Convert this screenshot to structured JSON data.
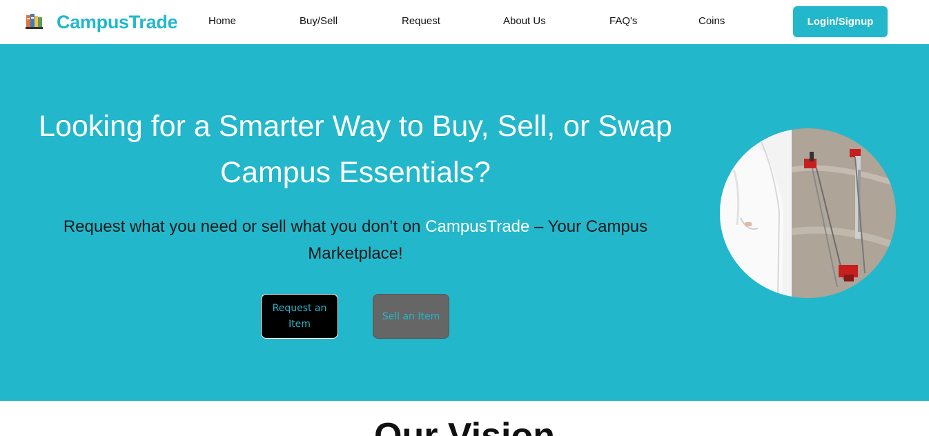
{
  "nav": {
    "brand": "CampusTrade",
    "links": [
      "Home",
      "Buy/Sell",
      "Request",
      "About Us",
      "FAQ's",
      "Coins"
    ],
    "login_label": "Login/Signup"
  },
  "hero": {
    "title": "Looking for a Smarter Way to Buy, Sell, or Swap Campus Essentials?",
    "subtitle_pre": "Request what you need or sell what you don’t on ",
    "subtitle_brand": "CampusTrade",
    "subtitle_post": " – Your Campus Marketplace!",
    "request_button": "Request an Item",
    "sell_button": "Sell an Item"
  },
  "vision": {
    "heading": "Our Vision"
  },
  "colors": {
    "accent": "#23b7cb",
    "request_button_bg": "#000000",
    "sell_button_bg": "#666666"
  },
  "icons": {
    "brand_logo": "books-icon"
  }
}
